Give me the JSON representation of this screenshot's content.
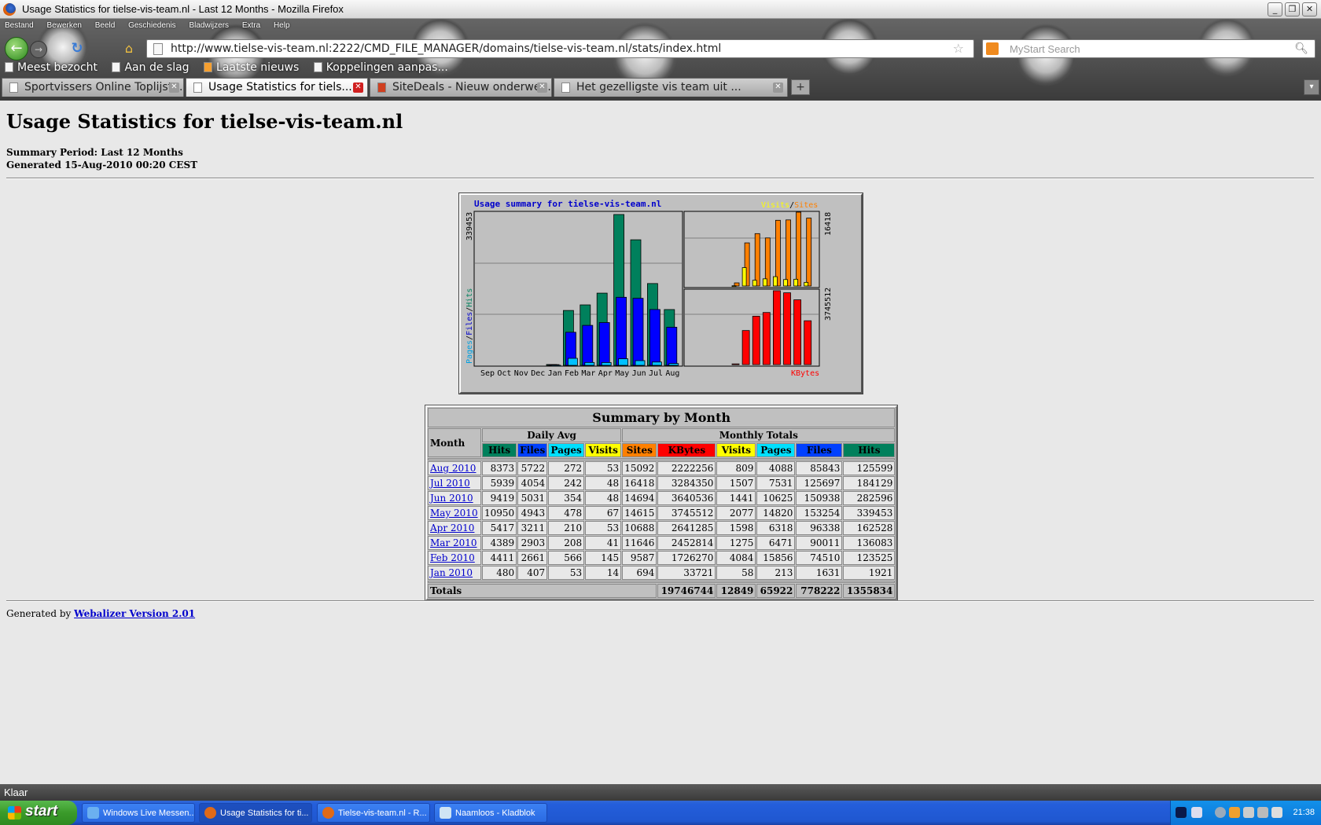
{
  "window": {
    "title": "Usage Statistics for tielse-vis-team.nl - Last 12 Months - Mozilla Firefox"
  },
  "menu": [
    "Bestand",
    "Bewerken",
    "Beeld",
    "Geschiedenis",
    "Bladwijzers",
    "Extra",
    "Help"
  ],
  "nav": {
    "url": "http://www.tielse-vis-team.nl:2222/CMD_FILE_MANAGER/domains/tielse-vis-team.nl/stats/index.html",
    "search_placeholder": "MyStart Search"
  },
  "bookmarks": [
    "Meest bezocht",
    "Aan de slag",
    "Laatste nieuws",
    "Koppelingen aanpas..."
  ],
  "tabs": [
    "Sportvissers Online Toplijst ...",
    "Usage Statistics for tiels...",
    "SiteDeals - Nieuw onderwer...",
    "Het gezelligste vis team uit ..."
  ],
  "page": {
    "title": "Usage Statistics for tielse-vis-team.nl",
    "period": "Summary Period: Last 12 Months",
    "generated": "Generated 15-Aug-2010 00:20 CEST",
    "footer_prefix": "Generated by",
    "footer_link": "Webalizer Version 2.01"
  },
  "chart_data": {
    "type": "bar",
    "title": "Usage summary for tielse-vis-team.nl",
    "categories": [
      "Sep",
      "Oct",
      "Nov",
      "Dec",
      "Jan",
      "Feb",
      "Mar",
      "Apr",
      "May",
      "Jun",
      "Jul",
      "Aug"
    ],
    "left_axis_max_label": "339453",
    "left_legend": [
      "Pages",
      "/",
      "Files",
      "/",
      "Hits"
    ],
    "right_top_max_label": "16418",
    "right_top_legend": [
      "Visits",
      "/",
      "Sites"
    ],
    "right_bottom_max_label": "3745512",
    "right_bottom_legend": "KBytes",
    "series": [
      {
        "name": "Hits",
        "values": [
          0,
          0,
          0,
          0,
          1921,
          123525,
          136083,
          162528,
          339453,
          282596,
          184129,
          125599
        ]
      },
      {
        "name": "Files",
        "values": [
          0,
          0,
          0,
          0,
          1631,
          74510,
          90011,
          96338,
          153254,
          150938,
          125697,
          85843
        ]
      },
      {
        "name": "Pages",
        "values": [
          0,
          0,
          0,
          0,
          213,
          15856,
          6471,
          6318,
          14820,
          10625,
          7531,
          4088
        ]
      },
      {
        "name": "Visits",
        "values": [
          0,
          0,
          0,
          0,
          58,
          4084,
          1275,
          1598,
          2077,
          1441,
          1507,
          809
        ]
      },
      {
        "name": "Sites",
        "values": [
          0,
          0,
          0,
          0,
          694,
          9587,
          11646,
          10688,
          14615,
          14694,
          16418,
          15092
        ]
      },
      {
        "name": "KBytes",
        "values": [
          0,
          0,
          0,
          0,
          33721,
          1726270,
          2452814,
          2641285,
          3745512,
          3640536,
          3284350,
          2222256
        ]
      }
    ],
    "colors": {
      "Hits": "#00805c",
      "Files": "#0000ff",
      "Pages": "#00c0ff",
      "Visits": "#ffff00",
      "Sites": "#ff8000",
      "KBytes": "#ff0000"
    }
  },
  "summary": {
    "title": "Summary by Month",
    "month_header": "Month",
    "daily_avg": "Daily Avg",
    "monthly_totals": "Monthly Totals",
    "daily_cols": [
      "Hits",
      "Files",
      "Pages",
      "Visits"
    ],
    "monthly_cols": [
      "Sites",
      "KBytes",
      "Visits",
      "Pages",
      "Files",
      "Hits"
    ],
    "rows": [
      {
        "month": "Aug 2010",
        "v": [
          "8373",
          "5722",
          "272",
          "53",
          "15092",
          "2222256",
          "809",
          "4088",
          "85843",
          "125599"
        ]
      },
      {
        "month": "Jul 2010",
        "v": [
          "5939",
          "4054",
          "242",
          "48",
          "16418",
          "3284350",
          "1507",
          "7531",
          "125697",
          "184129"
        ]
      },
      {
        "month": "Jun 2010",
        "v": [
          "9419",
          "5031",
          "354",
          "48",
          "14694",
          "3640536",
          "1441",
          "10625",
          "150938",
          "282596"
        ]
      },
      {
        "month": "May 2010",
        "v": [
          "10950",
          "4943",
          "478",
          "67",
          "14615",
          "3745512",
          "2077",
          "14820",
          "153254",
          "339453"
        ]
      },
      {
        "month": "Apr 2010",
        "v": [
          "5417",
          "3211",
          "210",
          "53",
          "10688",
          "2641285",
          "1598",
          "6318",
          "96338",
          "162528"
        ]
      },
      {
        "month": "Mar 2010",
        "v": [
          "4389",
          "2903",
          "208",
          "41",
          "11646",
          "2452814",
          "1275",
          "6471",
          "90011",
          "136083"
        ]
      },
      {
        "month": "Feb 2010",
        "v": [
          "4411",
          "2661",
          "566",
          "145",
          "9587",
          "1726270",
          "4084",
          "15856",
          "74510",
          "123525"
        ]
      },
      {
        "month": "Jan 2010",
        "v": [
          "480",
          "407",
          "53",
          "14",
          "694",
          "33721",
          "58",
          "213",
          "1631",
          "1921"
        ]
      }
    ],
    "totals_label": "Totals",
    "totals": [
      "19746744",
      "12849",
      "65922",
      "778222",
      "1355834"
    ]
  },
  "status": "Klaar",
  "taskbar": {
    "start": "start",
    "items": [
      "Windows Live Messen...",
      "Usage Statistics for ti...",
      "Tielse-vis-team.nl - R...",
      "Naamloos - Kladblok"
    ],
    "clock": "21:38"
  }
}
